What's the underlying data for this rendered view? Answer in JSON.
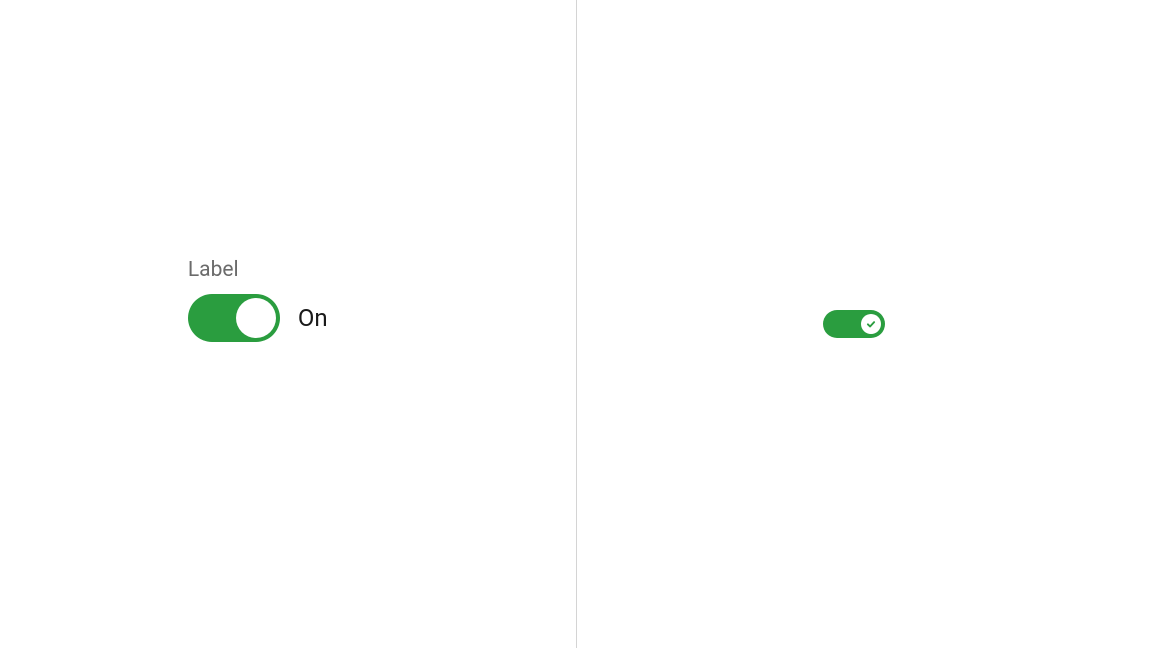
{
  "left_panel": {
    "label": "Label",
    "toggle": {
      "state_text": "On",
      "on": true
    }
  },
  "right_panel": {
    "toggle": {
      "on": true,
      "icon": "checkmark"
    }
  },
  "colors": {
    "toggle_active": "#2a9d3f",
    "label_text": "#6b6b6b",
    "state_text": "#1a1a1a"
  }
}
